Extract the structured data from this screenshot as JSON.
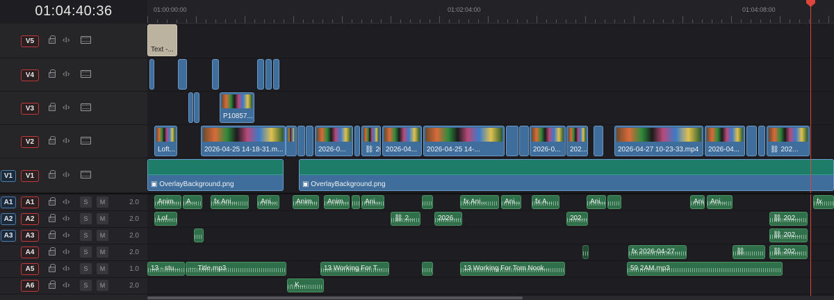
{
  "timecode": "01:04:40:36",
  "ruler": {
    "labels": [
      {
        "text": "01:00:00:00",
        "frac": 0.005
      },
      {
        "text": "01:02:04:00",
        "frac": 0.433
      },
      {
        "text": "01:04:08:00",
        "frac": 0.862
      }
    ]
  },
  "playhead_frac": 0.966,
  "video_tracks": [
    {
      "id": "v5",
      "label": "V5",
      "clips": [
        {
          "kind": "txt",
          "start": 0.0,
          "end": 0.044,
          "label": "Text -..."
        }
      ]
    },
    {
      "id": "v4",
      "label": "V4",
      "clips": [
        {
          "kind": "vid",
          "start": 0.003,
          "end": 0.01
        },
        {
          "kind": "vid",
          "start": 0.045,
          "end": 0.058
        },
        {
          "kind": "vid",
          "start": 0.094,
          "end": 0.104
        },
        {
          "kind": "vid",
          "start": 0.16,
          "end": 0.17
        },
        {
          "kind": "vid",
          "start": 0.172,
          "end": 0.181
        },
        {
          "kind": "vid",
          "start": 0.183,
          "end": 0.192
        }
      ]
    },
    {
      "id": "v3",
      "label": "V3",
      "clips": [
        {
          "kind": "vid",
          "start": 0.06,
          "end": 0.067
        },
        {
          "kind": "vid",
          "start": 0.068,
          "end": 0.076
        },
        {
          "kind": "vid",
          "start": 0.105,
          "end": 0.156,
          "thumb": true,
          "label": "P10857..."
        }
      ]
    },
    {
      "id": "v2",
      "label": "V2",
      "clips": [
        {
          "kind": "vid",
          "start": 0.01,
          "end": 0.044,
          "thumb": true,
          "label": "Loft..."
        },
        {
          "kind": "vid",
          "start": 0.078,
          "end": 0.201,
          "thumb": true,
          "label": "2026-04-25 14-18-31.m..."
        },
        {
          "kind": "vid",
          "start": 0.201,
          "end": 0.218,
          "thumb": true
        },
        {
          "kind": "vid",
          "start": 0.219,
          "end": 0.23
        },
        {
          "kind": "vid",
          "start": 0.231,
          "end": 0.242
        },
        {
          "kind": "vid",
          "start": 0.244,
          "end": 0.3,
          "thumb": true,
          "label": "2026-0..."
        },
        {
          "kind": "vid",
          "start": 0.302,
          "end": 0.31
        },
        {
          "kind": "vid",
          "start": 0.312,
          "end": 0.34,
          "thumb": true,
          "label": "⛓ 2026..."
        },
        {
          "kind": "vid",
          "start": 0.342,
          "end": 0.4,
          "thumb": true,
          "label": "2026-04..."
        },
        {
          "kind": "vid",
          "start": 0.402,
          "end": 0.52,
          "thumb": true,
          "label": "2026-04-25 14-..."
        },
        {
          "kind": "vid",
          "start": 0.522,
          "end": 0.54
        },
        {
          "kind": "vid",
          "start": 0.541,
          "end": 0.556
        },
        {
          "kind": "vid",
          "start": 0.557,
          "end": 0.609,
          "thumb": true,
          "label": "2026-0..."
        },
        {
          "kind": "vid",
          "start": 0.61,
          "end": 0.642,
          "thumb": true,
          "label": "202..."
        },
        {
          "kind": "vid",
          "start": 0.65,
          "end": 0.664
        },
        {
          "kind": "vid",
          "start": 0.68,
          "end": 0.81,
          "thumb": true,
          "label": "2026-04-27 10-23-33.mp4"
        },
        {
          "kind": "vid",
          "start": 0.812,
          "end": 0.87,
          "thumb": true,
          "label": "2026-04..."
        },
        {
          "kind": "vid",
          "start": 0.872,
          "end": 0.888
        },
        {
          "kind": "vid",
          "start": 0.89,
          "end": 0.9
        },
        {
          "kind": "vid",
          "start": 0.902,
          "end": 0.965,
          "thumb": true,
          "label": "⛓ 202..."
        }
      ]
    },
    {
      "id": "v1",
      "label": "V1",
      "source": "V1",
      "comp": true,
      "clips": [
        {
          "kind": "comp",
          "start": 0.0,
          "end": 0.198,
          "label": "▣ OverlayBackground.png"
        },
        {
          "kind": "comp",
          "start": 0.221,
          "end": 1.0,
          "label": "▣ OverlayBackground.png"
        }
      ]
    }
  ],
  "audio_tracks": [
    {
      "id": "a1",
      "label": "A1",
      "source": "A1",
      "level": "2.0",
      "clips": [
        {
          "start": 0.01,
          "end": 0.05,
          "label": "Anim..."
        },
        {
          "start": 0.052,
          "end": 0.08,
          "label": "A..."
        },
        {
          "start": 0.092,
          "end": 0.148,
          "label": "fx Ani..."
        },
        {
          "start": 0.16,
          "end": 0.192,
          "label": "Ani..."
        },
        {
          "start": 0.212,
          "end": 0.25,
          "label": "Anim..."
        },
        {
          "start": 0.257,
          "end": 0.295,
          "label": "Anim..."
        },
        {
          "start": 0.298,
          "end": 0.31
        },
        {
          "start": 0.312,
          "end": 0.345,
          "label": "Ani..."
        },
        {
          "start": 0.4,
          "end": 0.416
        },
        {
          "start": 0.455,
          "end": 0.512,
          "label": "fx Ani..."
        },
        {
          "start": 0.515,
          "end": 0.545,
          "label": "Ani..."
        },
        {
          "start": 0.56,
          "end": 0.6,
          "label": "fx A..."
        },
        {
          "start": 0.64,
          "end": 0.668,
          "label": "Ani..."
        },
        {
          "start": 0.67,
          "end": 0.69
        },
        {
          "start": 0.79,
          "end": 0.812,
          "label": "Ani..."
        },
        {
          "start": 0.815,
          "end": 0.852,
          "label": "Ani..."
        },
        {
          "start": 0.97,
          "end": 1.0,
          "label": "fx"
        }
      ]
    },
    {
      "id": "a2",
      "label": "A2",
      "source": "A2",
      "level": "2.0",
      "clips": [
        {
          "start": 0.01,
          "end": 0.044,
          "label": "Lof..."
        },
        {
          "start": 0.354,
          "end": 0.398,
          "label": "⛓ 2..."
        },
        {
          "start": 0.418,
          "end": 0.458,
          "label": "2026..."
        },
        {
          "start": 0.61,
          "end": 0.642,
          "label": "202..."
        },
        {
          "start": 0.906,
          "end": 0.962,
          "label": "⛓ 202..."
        }
      ]
    },
    {
      "id": "a3",
      "label": "A3",
      "source": "A3",
      "level": "2.0",
      "clips": [
        {
          "start": 0.068,
          "end": 0.082
        },
        {
          "start": 0.906,
          "end": 0.962,
          "label": "⛓ 202..."
        }
      ]
    },
    {
      "id": "a4",
      "label": "A4",
      "level": "2.0",
      "clips": [
        {
          "start": 0.634,
          "end": 0.643,
          "dark": true
        },
        {
          "start": 0.7,
          "end": 0.785,
          "label": "fx 2026-04-27..."
        },
        {
          "start": 0.852,
          "end": 0.9,
          "label": "⛓"
        },
        {
          "start": 0.906,
          "end": 0.962,
          "label": "⛓ 202..."
        }
      ]
    },
    {
      "id": "a5",
      "label": "A5",
      "level": "1.0",
      "clips": [
        {
          "start": 0.0,
          "end": 0.055,
          "label": "13 - stu..."
        },
        {
          "start": 0.056,
          "end": 0.202,
          "label": "··· Title.mp3"
        },
        {
          "start": 0.252,
          "end": 0.352,
          "label": "13 Working For T..."
        },
        {
          "start": 0.4,
          "end": 0.416
        },
        {
          "start": 0.455,
          "end": 0.608,
          "label": "13 Working For Tom Nook..."
        },
        {
          "start": 0.698,
          "end": 0.925,
          "label": "59 2AM.mp3"
        }
      ]
    },
    {
      "id": "a6",
      "label": "A6",
      "level": "2.0",
      "clips": [
        {
          "start": 0.203,
          "end": 0.257,
          "label": "· K..."
        }
      ]
    }
  ]
}
